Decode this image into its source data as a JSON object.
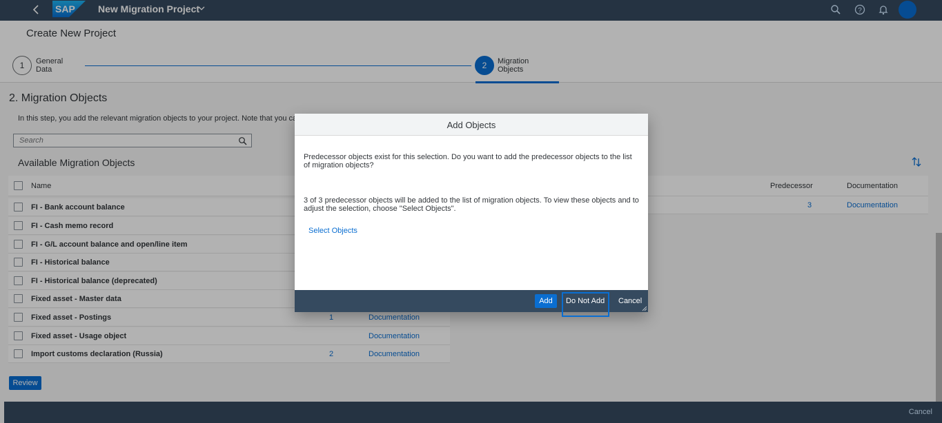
{
  "shell": {
    "app_title": "New Migration Project",
    "logo_text": "SAP"
  },
  "header": {
    "page_title": "Create New Project",
    "steps": [
      {
        "number": "1",
        "label_line1": "General",
        "label_line2": "Data"
      },
      {
        "number": "2",
        "label_line1": "Migration",
        "label_line2": "Objects"
      }
    ]
  },
  "main": {
    "section_title": "2. Migration Objects",
    "description": "In this step, you add the relevant migration objects to your project. Note that you can",
    "search_placeholder": "Search",
    "table_title": "Available Migration Objects",
    "columns": {
      "name": "Name",
      "predecessor": "Predecessor",
      "documentation": "Documentation"
    },
    "right_row": {
      "predecessor": "3",
      "documentation": "Documentation"
    },
    "rows": [
      {
        "name": "FI - Bank account balance",
        "predecessor": "",
        "documentation": ""
      },
      {
        "name": "FI - Cash memo record",
        "predecessor": "",
        "documentation": ""
      },
      {
        "name": "FI - G/L account balance and open/line item",
        "predecessor": "",
        "documentation": ""
      },
      {
        "name": "FI - Historical balance",
        "predecessor": "",
        "documentation": ""
      },
      {
        "name": "FI - Historical balance (deprecated)",
        "predecessor": "",
        "documentation": ""
      },
      {
        "name": "Fixed asset - Master data",
        "predecessor": "",
        "documentation": ""
      },
      {
        "name": "Fixed asset - Postings",
        "predecessor": "1",
        "documentation": "Documentation"
      },
      {
        "name": "Fixed asset - Usage object",
        "predecessor": "",
        "documentation": "Documentation"
      },
      {
        "name": "Import customs declaration (Russia)",
        "predecessor": "2",
        "documentation": "Documentation"
      }
    ],
    "review_label": "Review"
  },
  "footer": {
    "cancel_label": "Cancel"
  },
  "dialog": {
    "title": "Add Objects",
    "text1": "Predecessor objects exist for this selection. Do you want to add the predecessor objects to the list of migration objects?",
    "text2": "3 of 3 predecessor objects will be added to the list of migration objects. To view these objects and to adjust the selection, choose \"Select Objects\".",
    "select_link": "Select Objects",
    "add_label": "Add",
    "not_add_label": "Do Not Add",
    "cancel_label": "Cancel"
  },
  "colors": {
    "shell": "#354a5f",
    "accent": "#0a6ed1"
  }
}
